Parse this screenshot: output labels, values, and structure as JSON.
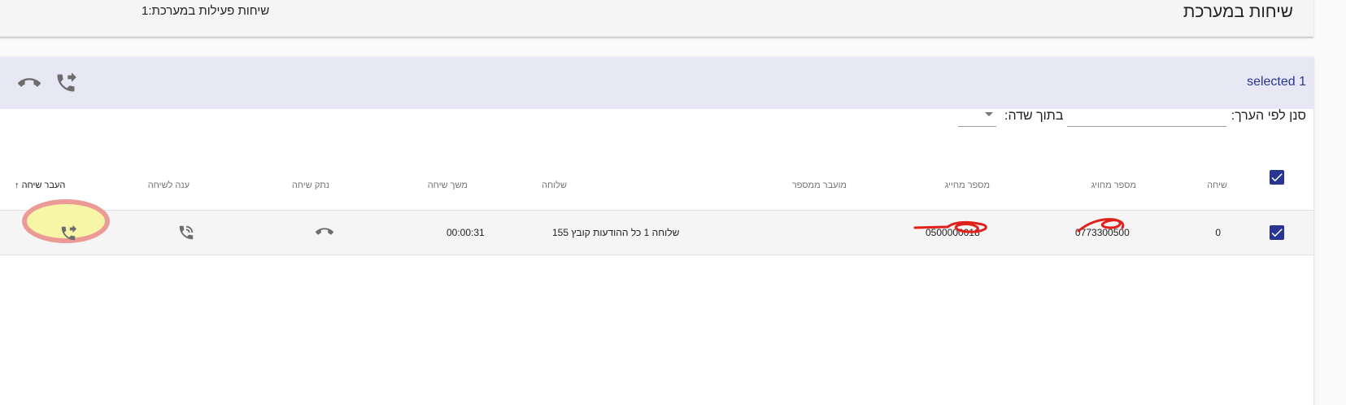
{
  "header": {
    "title": "שיחות במערכת",
    "active_calls": "שיחות פעילות במערכת:1"
  },
  "toolbar": {
    "selected": "selected 1",
    "icons": [
      "hangup-icon",
      "transfer-call-icon"
    ]
  },
  "filter": {
    "value_label": "סנן לפי הערך:",
    "value_input": "",
    "field_label": "בתוך שדה:",
    "field_selected": ""
  },
  "table": {
    "columns": {
      "call": "שיחה",
      "billed_number": "מספר מחויג",
      "caller_number": "מספר מחייג",
      "transferred_from": "מועבר ממספר",
      "extension": "שלוחה",
      "duration": "משך שיחה",
      "hangup": "נתק שיחה",
      "answer": "ענה לשיחה",
      "transfer": "העבר שיחה"
    },
    "sort_indicator": "↑",
    "rows": [
      {
        "call": "0",
        "billed_number": "0773300500",
        "caller_number": "0500000018",
        "transferred_from": "",
        "extension": "שלוחה 1 כל ההודעות קובץ 155",
        "duration": "00:00:31"
      }
    ]
  },
  "colors": {
    "accent": "#283593",
    "toolbar_bg": "#e8e8f5",
    "icon": "#6d6d6d",
    "highlight_fill": "#f7f5a6",
    "highlight_ring": "#ec9a96",
    "redaction": "#e0201b"
  }
}
